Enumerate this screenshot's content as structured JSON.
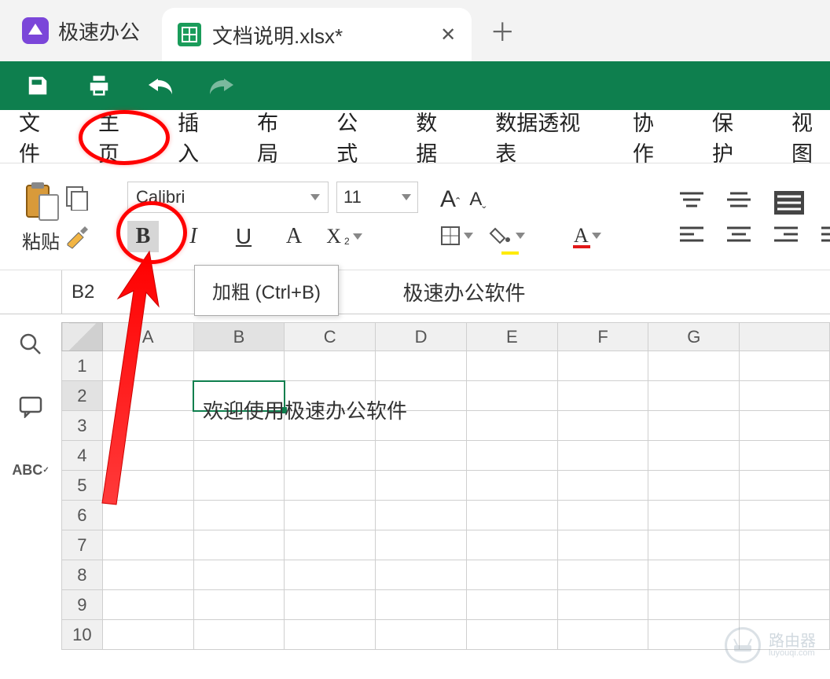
{
  "tabs": {
    "app_name": "极速办公",
    "doc_name": "文档说明.xlsx*",
    "close": "✕",
    "new": "＋"
  },
  "menu": {
    "file": "文件",
    "home": "主页",
    "insert": "插入",
    "layout": "布局",
    "formula": "公式",
    "data": "数据",
    "pivot": "数据透视表",
    "collab": "协作",
    "protect": "保护",
    "view": "视图"
  },
  "ribbon": {
    "paste": "粘贴",
    "font": "Calibri",
    "size": "11",
    "bold": "B",
    "italic": "I",
    "underline": "U",
    "clear_a": "A",
    "x2": "X",
    "x2_sub": "2",
    "font_grow": "A",
    "font_shrink": "A"
  },
  "tooltip": "加粗 (Ctrl+B)",
  "name_box": "B2",
  "formula_text": "极速办公软件",
  "columns": [
    "A",
    "B",
    "C",
    "D",
    "E",
    "F",
    "G"
  ],
  "rows": [
    "1",
    "2",
    "3",
    "4",
    "5",
    "6",
    "7",
    "8",
    "9",
    "10"
  ],
  "cell_content": "欢迎使用极速办公软件",
  "watermark": {
    "main": "路由器",
    "sub": "luyouqi.com"
  }
}
